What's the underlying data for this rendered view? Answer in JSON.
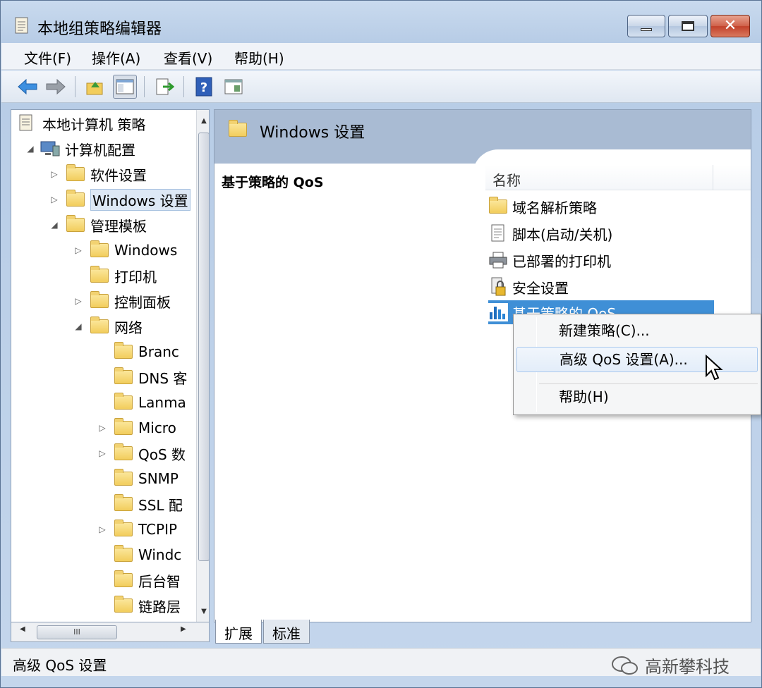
{
  "window": {
    "title": "本地组策略编辑器"
  },
  "menubar": {
    "items": [
      "文件(F)",
      "操作(A)",
      "查看(V)",
      "帮助(H)"
    ]
  },
  "toolbar": {
    "icons": [
      "back-icon",
      "forward-icon",
      "up-folder-icon",
      "show-hide-tree-icon",
      "export-icon",
      "help-icon",
      "properties-icon"
    ]
  },
  "tree": {
    "items": [
      {
        "label": "本地计算机 策略",
        "level": 0,
        "arrow": ""
      },
      {
        "label": "计算机配置",
        "level": 1,
        "arrow": "◢"
      },
      {
        "label": "软件设置",
        "level": 2,
        "arrow": "▷"
      },
      {
        "label": "Windows 设置",
        "level": 2,
        "arrow": "▷"
      },
      {
        "label": "管理模板",
        "level": 2,
        "arrow": "◢"
      },
      {
        "label": "Windows",
        "level": 3,
        "arrow": "▷"
      },
      {
        "label": "打印机",
        "level": 3,
        "arrow": ""
      },
      {
        "label": "控制面板",
        "level": 3,
        "arrow": "▷"
      },
      {
        "label": "网络",
        "level": 3,
        "arrow": "◢"
      },
      {
        "label": "Branc",
        "level": 4,
        "arrow": ""
      },
      {
        "label": "DNS 客",
        "level": 4,
        "arrow": ""
      },
      {
        "label": "Lanma",
        "level": 4,
        "arrow": ""
      },
      {
        "label": "Micro",
        "level": 4,
        "arrow": "▷"
      },
      {
        "label": "QoS 数",
        "level": 4,
        "arrow": "▷"
      },
      {
        "label": "SNMP",
        "level": 4,
        "arrow": ""
      },
      {
        "label": "SSL 配",
        "level": 4,
        "arrow": ""
      },
      {
        "label": "TCPIP",
        "level": 4,
        "arrow": "▷"
      },
      {
        "label": "Windc",
        "level": 4,
        "arrow": ""
      },
      {
        "label": "后台智",
        "level": 4,
        "arrow": ""
      },
      {
        "label": "链路层",
        "level": 4,
        "arrow": ""
      }
    ],
    "hscroll_thumb": "III"
  },
  "right": {
    "header_title": "Windows 设置",
    "desc_title": "基于策略的 QoS",
    "column_name": "名称",
    "items": [
      {
        "label": "域名解析策略",
        "icon": "folder-icon"
      },
      {
        "label": "脚本(启动/关机)",
        "icon": "script-icon"
      },
      {
        "label": "已部署的打印机",
        "icon": "printer-icon"
      },
      {
        "label": "安全设置",
        "icon": "security-icon"
      },
      {
        "label": "基于策略的 QoS",
        "icon": "qos-chart-icon"
      }
    ],
    "tabs": [
      "扩展",
      "标准"
    ]
  },
  "context_menu": {
    "items": [
      "新建策略(C)...",
      "高级 QoS 设置(A)...",
      "帮助(H)"
    ]
  },
  "statusbar": {
    "text": "高级 QoS 设置",
    "watermark": "高新攀科技"
  }
}
